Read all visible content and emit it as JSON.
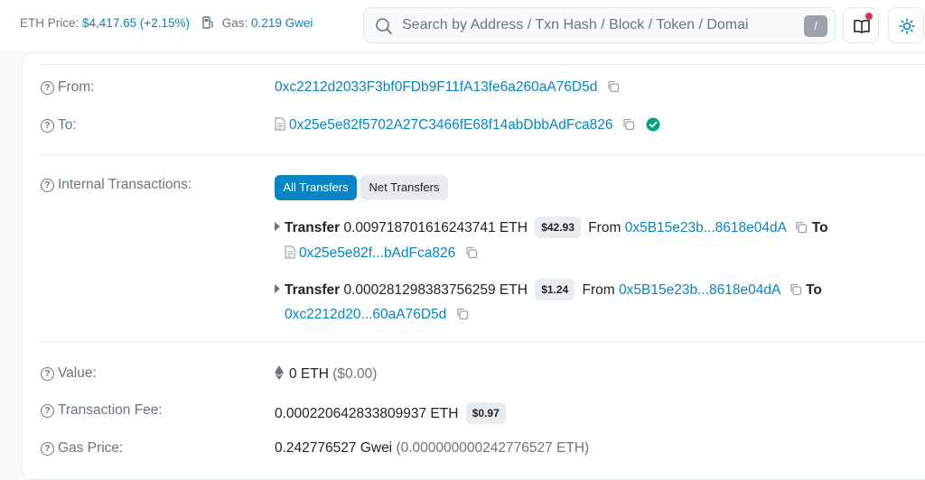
{
  "header": {
    "eth_price_label": "ETH Price:",
    "eth_price_value": "$4,417.65 (+2.15%)",
    "gas_label": "Gas:",
    "gas_value": "0.219 Gwei",
    "search_placeholder": "Search by Address / Txn Hash / Block / Token / Domai",
    "search_shortcut": "/",
    "icons": [
      "gas-pump-icon",
      "search-icon",
      "book-icon",
      "sun-icon"
    ],
    "accent_color": "#0784c3",
    "notification_color": "#dc3545"
  },
  "tx": {
    "from": {
      "label": "From:",
      "address": "0xc2212d2033F3bf0FDb9F11fA13fe6a260aA76D5d"
    },
    "to": {
      "label": "To:",
      "address": "0x25e5e82f5702A27C3466fE68f14abDbbAdFca826"
    },
    "internal": {
      "label": "Internal Transactions:",
      "tabs": [
        "All Transfers",
        "Net Transfers"
      ],
      "transfers": [
        {
          "kw": "Transfer",
          "amount": "0.009718701616243741 ETH",
          "usd": "$42.93",
          "from_word": "From",
          "from": "0x5B15e23b...8618e04dA",
          "to_word": "To",
          "to": "0x25e5e82f...bAdFca826"
        },
        {
          "kw": "Transfer",
          "amount": "0.000281298383756259 ETH",
          "usd": "$1.24",
          "from_word": "From",
          "from": "0x5B15e23b...8618e04dA",
          "to_word": "To",
          "to": "0xc2212d20...60aA76D5d"
        }
      ]
    },
    "value": {
      "label": "Value:",
      "amount": "0 ETH",
      "usd": "($0.00)"
    },
    "fee": {
      "label": "Transaction Fee:",
      "amount": "0.000220642833809937 ETH",
      "usd": "$0.97"
    },
    "gas_price": {
      "label": "Gas Price:",
      "gwei": "0.242776527 Gwei",
      "eth": "(0.000000000242776527 ETH)"
    }
  }
}
